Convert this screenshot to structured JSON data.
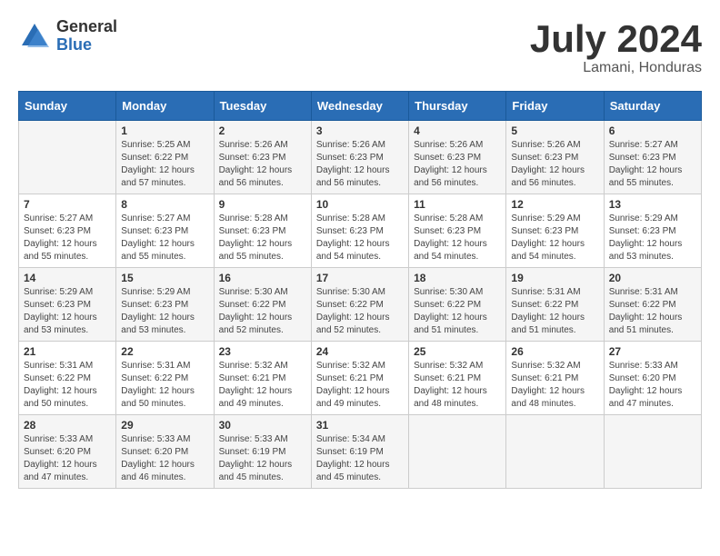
{
  "logo": {
    "general": "General",
    "blue": "Blue"
  },
  "title": "July 2024",
  "subtitle": "Lamani, Honduras",
  "days_of_week": [
    "Sunday",
    "Monday",
    "Tuesday",
    "Wednesday",
    "Thursday",
    "Friday",
    "Saturday"
  ],
  "weeks": [
    [
      {
        "day": "",
        "info": ""
      },
      {
        "day": "1",
        "info": "Sunrise: 5:25 AM\nSunset: 6:22 PM\nDaylight: 12 hours\nand 57 minutes."
      },
      {
        "day": "2",
        "info": "Sunrise: 5:26 AM\nSunset: 6:23 PM\nDaylight: 12 hours\nand 56 minutes."
      },
      {
        "day": "3",
        "info": "Sunrise: 5:26 AM\nSunset: 6:23 PM\nDaylight: 12 hours\nand 56 minutes."
      },
      {
        "day": "4",
        "info": "Sunrise: 5:26 AM\nSunset: 6:23 PM\nDaylight: 12 hours\nand 56 minutes."
      },
      {
        "day": "5",
        "info": "Sunrise: 5:26 AM\nSunset: 6:23 PM\nDaylight: 12 hours\nand 56 minutes."
      },
      {
        "day": "6",
        "info": "Sunrise: 5:27 AM\nSunset: 6:23 PM\nDaylight: 12 hours\nand 55 minutes."
      }
    ],
    [
      {
        "day": "7",
        "info": "Sunrise: 5:27 AM\nSunset: 6:23 PM\nDaylight: 12 hours\nand 55 minutes."
      },
      {
        "day": "8",
        "info": "Sunrise: 5:27 AM\nSunset: 6:23 PM\nDaylight: 12 hours\nand 55 minutes."
      },
      {
        "day": "9",
        "info": "Sunrise: 5:28 AM\nSunset: 6:23 PM\nDaylight: 12 hours\nand 55 minutes."
      },
      {
        "day": "10",
        "info": "Sunrise: 5:28 AM\nSunset: 6:23 PM\nDaylight: 12 hours\nand 54 minutes."
      },
      {
        "day": "11",
        "info": "Sunrise: 5:28 AM\nSunset: 6:23 PM\nDaylight: 12 hours\nand 54 minutes."
      },
      {
        "day": "12",
        "info": "Sunrise: 5:29 AM\nSunset: 6:23 PM\nDaylight: 12 hours\nand 54 minutes."
      },
      {
        "day": "13",
        "info": "Sunrise: 5:29 AM\nSunset: 6:23 PM\nDaylight: 12 hours\nand 53 minutes."
      }
    ],
    [
      {
        "day": "14",
        "info": "Sunrise: 5:29 AM\nSunset: 6:23 PM\nDaylight: 12 hours\nand 53 minutes."
      },
      {
        "day": "15",
        "info": "Sunrise: 5:29 AM\nSunset: 6:23 PM\nDaylight: 12 hours\nand 53 minutes."
      },
      {
        "day": "16",
        "info": "Sunrise: 5:30 AM\nSunset: 6:22 PM\nDaylight: 12 hours\nand 52 minutes."
      },
      {
        "day": "17",
        "info": "Sunrise: 5:30 AM\nSunset: 6:22 PM\nDaylight: 12 hours\nand 52 minutes."
      },
      {
        "day": "18",
        "info": "Sunrise: 5:30 AM\nSunset: 6:22 PM\nDaylight: 12 hours\nand 51 minutes."
      },
      {
        "day": "19",
        "info": "Sunrise: 5:31 AM\nSunset: 6:22 PM\nDaylight: 12 hours\nand 51 minutes."
      },
      {
        "day": "20",
        "info": "Sunrise: 5:31 AM\nSunset: 6:22 PM\nDaylight: 12 hours\nand 51 minutes."
      }
    ],
    [
      {
        "day": "21",
        "info": "Sunrise: 5:31 AM\nSunset: 6:22 PM\nDaylight: 12 hours\nand 50 minutes."
      },
      {
        "day": "22",
        "info": "Sunrise: 5:31 AM\nSunset: 6:22 PM\nDaylight: 12 hours\nand 50 minutes."
      },
      {
        "day": "23",
        "info": "Sunrise: 5:32 AM\nSunset: 6:21 PM\nDaylight: 12 hours\nand 49 minutes."
      },
      {
        "day": "24",
        "info": "Sunrise: 5:32 AM\nSunset: 6:21 PM\nDaylight: 12 hours\nand 49 minutes."
      },
      {
        "day": "25",
        "info": "Sunrise: 5:32 AM\nSunset: 6:21 PM\nDaylight: 12 hours\nand 48 minutes."
      },
      {
        "day": "26",
        "info": "Sunrise: 5:32 AM\nSunset: 6:21 PM\nDaylight: 12 hours\nand 48 minutes."
      },
      {
        "day": "27",
        "info": "Sunrise: 5:33 AM\nSunset: 6:20 PM\nDaylight: 12 hours\nand 47 minutes."
      }
    ],
    [
      {
        "day": "28",
        "info": "Sunrise: 5:33 AM\nSunset: 6:20 PM\nDaylight: 12 hours\nand 47 minutes."
      },
      {
        "day": "29",
        "info": "Sunrise: 5:33 AM\nSunset: 6:20 PM\nDaylight: 12 hours\nand 46 minutes."
      },
      {
        "day": "30",
        "info": "Sunrise: 5:33 AM\nSunset: 6:19 PM\nDaylight: 12 hours\nand 45 minutes."
      },
      {
        "day": "31",
        "info": "Sunrise: 5:34 AM\nSunset: 6:19 PM\nDaylight: 12 hours\nand 45 minutes."
      },
      {
        "day": "",
        "info": ""
      },
      {
        "day": "",
        "info": ""
      },
      {
        "day": "",
        "info": ""
      }
    ]
  ]
}
